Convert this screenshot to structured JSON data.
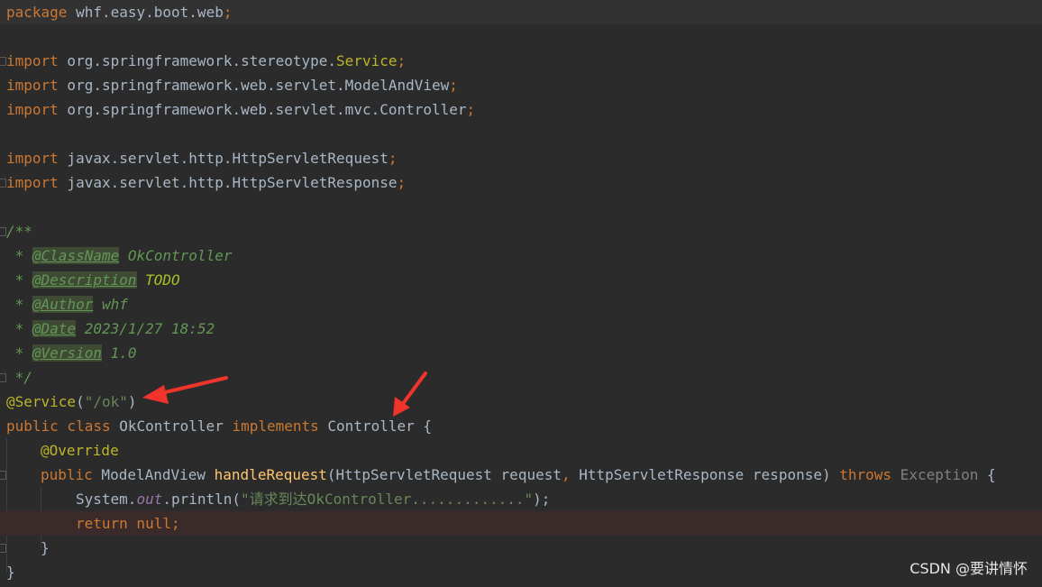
{
  "code": {
    "l1": {
      "kw": "package",
      "name": " whf.easy.boot.web",
      "semi": ";"
    },
    "l3": {
      "kw": "import",
      "pkg": " org.springframework.stereotype.",
      "cls": "Service",
      "semi": ";"
    },
    "l4": {
      "kw": "import",
      "pkg": " org.springframework.web.servlet.ModelAndView",
      "semi": ";"
    },
    "l5": {
      "kw": "import",
      "pkg": " org.springframework.web.servlet.mvc.Controller",
      "semi": ";"
    },
    "l7": {
      "kw": "import",
      "pkg": " javax.servlet.http.HttpServletRequest",
      "semi": ";"
    },
    "l8": {
      "kw": "import",
      "pkg": " javax.servlet.http.HttpServletResponse",
      "semi": ";"
    },
    "l10": {
      "text": "/**"
    },
    "l11": {
      "star": " * ",
      "tag": "@ClassName",
      "val": " OkController"
    },
    "l12": {
      "star": " * ",
      "tag": "@Description",
      "val": " TODO"
    },
    "l13": {
      "star": " * ",
      "tag": "@Author",
      "val": " whf"
    },
    "l14": {
      "star": " * ",
      "tag": "@Date",
      "val": " 2023/1/27 18:52"
    },
    "l15": {
      "star": " * ",
      "tag": "@Version",
      "val": " 1.0"
    },
    "l16": {
      "text": " */"
    },
    "l17": {
      "ann": "@Service",
      "open": "(",
      "str": "\"/ok\"",
      "close": ")"
    },
    "l18": {
      "kw1": "public class",
      "name": " OkController ",
      "kw2": "implements",
      "iface": " Controller {"
    },
    "l19": {
      "ann": "@Override"
    },
    "l20": {
      "kw1": "public",
      "ret": " ModelAndView ",
      "method": "handleRequest",
      "p1": "(HttpServletRequest request",
      "comma": ",",
      "p2": " HttpServletResponse response) ",
      "kw2": "throws",
      "exc": " Exception",
      "brace": " {"
    },
    "l21": {
      "obj": "System.",
      "field": "out",
      "call": ".println(",
      "str": "\"请求到达OkController.............\"",
      "end": ");"
    },
    "l22": {
      "kw": "return null",
      "semi": ";"
    },
    "l23": {
      "text": "}"
    },
    "l24": {
      "text": "}"
    }
  },
  "watermark": "CSDN @要讲情怀",
  "colors": {
    "background": "#2b2b2b",
    "keyword": "#cc7832",
    "annotation": "#bbb529",
    "string": "#6a8759",
    "comment": "#629755",
    "method": "#ffc66d",
    "arrow": "#f0342b"
  }
}
